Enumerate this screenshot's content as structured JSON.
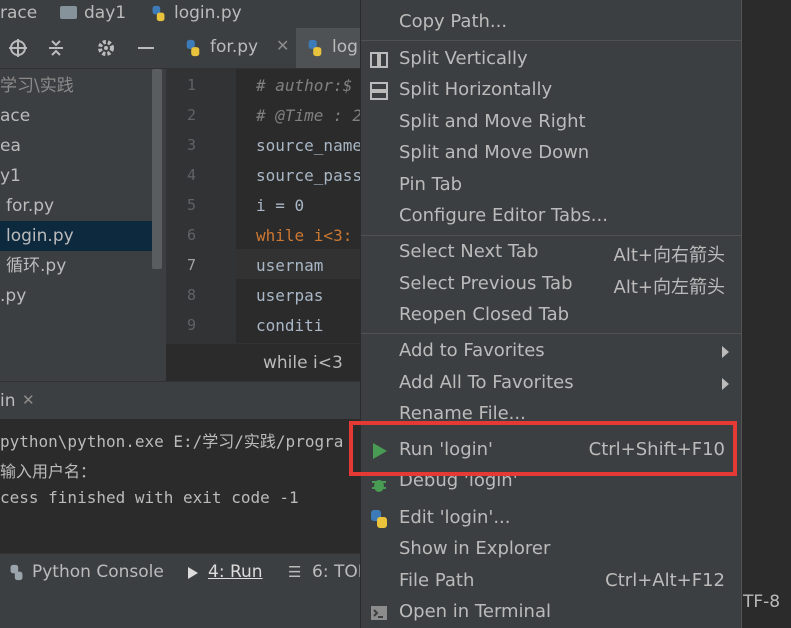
{
  "navbar": {
    "crumb1": "race",
    "crumb2": "day1",
    "crumb3": "login.py"
  },
  "tabs": [
    {
      "label": "for.py"
    },
    {
      "label": "log"
    }
  ],
  "tree": {
    "root": "学习\\实践",
    "items": [
      "ace",
      "ea",
      "y1",
      "for.py",
      "login.py",
      "循环.py",
      ".py"
    ]
  },
  "editor": {
    "line_numbers": [
      "1",
      "2",
      "3",
      "4",
      "5",
      "6",
      "7",
      "8",
      "9"
    ],
    "lines": [
      "# author:$",
      "# @Time : 2",
      "source_name",
      "source_pass",
      "i = 0",
      "while i<3:",
      "    usernam",
      "    userpas",
      "    conditi"
    ],
    "breadcrumb": "while i<3"
  },
  "run_panel": {
    "title": "in",
    "console_lines": [
      "python\\python.exe E:/学习/实践/progra",
      "输入用户名：",
      "cess finished with exit code -1"
    ]
  },
  "bottom_tabs": {
    "python_console": "Python Console",
    "run": "4: Run",
    "todo": "6: TOD"
  },
  "status": {
    "encoding": "TF-8"
  },
  "menu": {
    "items": [
      {
        "label": "Copy Path...",
        "shortcut": ""
      },
      {
        "label": "Split Vertically",
        "shortcut": ""
      },
      {
        "label": "Split Horizontally",
        "shortcut": ""
      },
      {
        "label": "Split and Move Right",
        "shortcut": ""
      },
      {
        "label": "Split and Move Down",
        "shortcut": ""
      },
      {
        "label": "Pin Tab",
        "shortcut": ""
      },
      {
        "label": "Configure Editor Tabs...",
        "shortcut": ""
      },
      {
        "label": "Select Next Tab",
        "shortcut": "Alt+向右箭头"
      },
      {
        "label": "Select Previous Tab",
        "shortcut": "Alt+向左箭头"
      },
      {
        "label": "Reopen Closed Tab",
        "shortcut": ""
      },
      {
        "label": "Add to Favorites",
        "shortcut": ""
      },
      {
        "label": "Add All To Favorites",
        "shortcut": ""
      },
      {
        "label": "Rename File...",
        "shortcut": ""
      },
      {
        "label": "Run 'login'",
        "shortcut": "Ctrl+Shift+F10"
      },
      {
        "label": "Debug 'login'",
        "shortcut": ""
      },
      {
        "label": "Edit 'login'...",
        "shortcut": ""
      },
      {
        "label": "Show in Explorer",
        "shortcut": ""
      },
      {
        "label": "File Path",
        "shortcut": "Ctrl+Alt+F12"
      },
      {
        "label": "Open in Terminal",
        "shortcut": ""
      }
    ]
  },
  "colors": {
    "highlight_border": "#e53935",
    "run_icon": "#499c54",
    "selection": "#0d293e"
  }
}
